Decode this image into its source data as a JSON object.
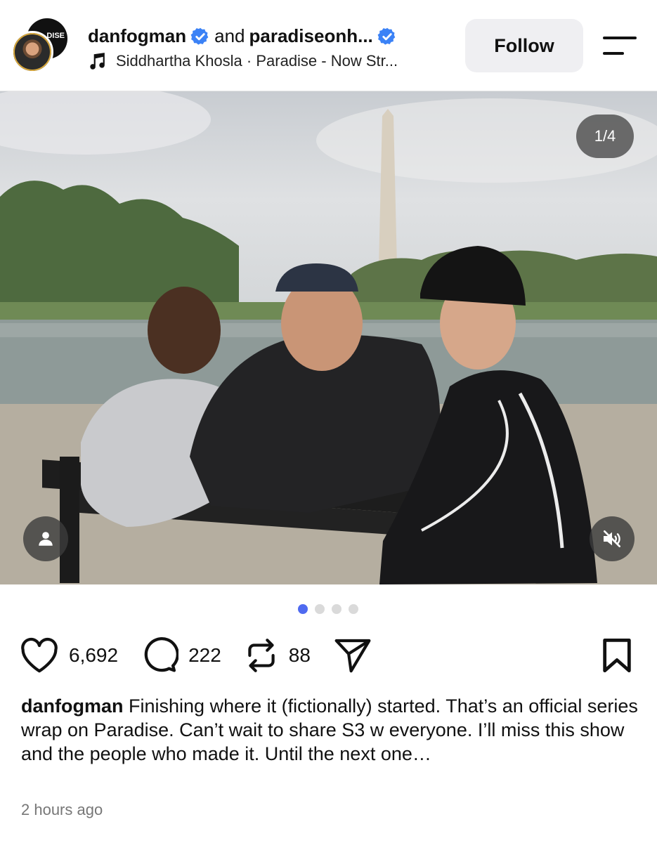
{
  "header": {
    "user1": "danfogman",
    "conjunction": "and",
    "user2": "paradiseonh...",
    "audio": "Siddhartha Khosla · Paradise - Now Str...",
    "follow_label": "Follow",
    "avatar_back_text": "DISE"
  },
  "media": {
    "counter": "1/4",
    "total_slides": 4,
    "active_slide": 1,
    "tag_icon": "person-icon",
    "mute_icon": "muted-speaker-icon"
  },
  "actions": {
    "likes": "6,692",
    "comments": "222",
    "reposts": "88"
  },
  "caption": {
    "user": "danfogman",
    "text": "Finishing where it (fictionally) started. That’s an official series wrap on Paradise.  Can’t wait to share S3 w everyone. I’ll miss this show and the people who made it. Until the next one…"
  },
  "timestamp": "2 hours ago",
  "colors": {
    "verified": "#3b82f6",
    "dot_active": "#4f6af0",
    "follow_bg": "#efeff2"
  }
}
